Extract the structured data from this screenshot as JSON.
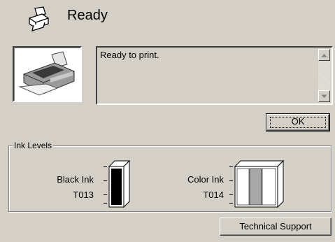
{
  "header": {
    "title": "Ready"
  },
  "status": {
    "message": "Ready to print."
  },
  "buttons": {
    "ok": "OK",
    "technical_support": "Technical Support"
  },
  "ink_levels": {
    "group_label": "Ink Levels",
    "black": {
      "name": "Black Ink",
      "code": "T013",
      "level": 1.0
    },
    "color": {
      "name": "Color Ink",
      "code": "T014",
      "level": 1.0
    }
  },
  "colors": {
    "window_bg": "#d4d0c8",
    "black_ink": "#000000",
    "color_ink_middle": "#a8a8a8"
  },
  "icons": {
    "header": "printer-icon",
    "picture": "inkjet-printer-image",
    "scroll_up": "arrow-up-icon",
    "scroll_down": "arrow-down-icon"
  }
}
